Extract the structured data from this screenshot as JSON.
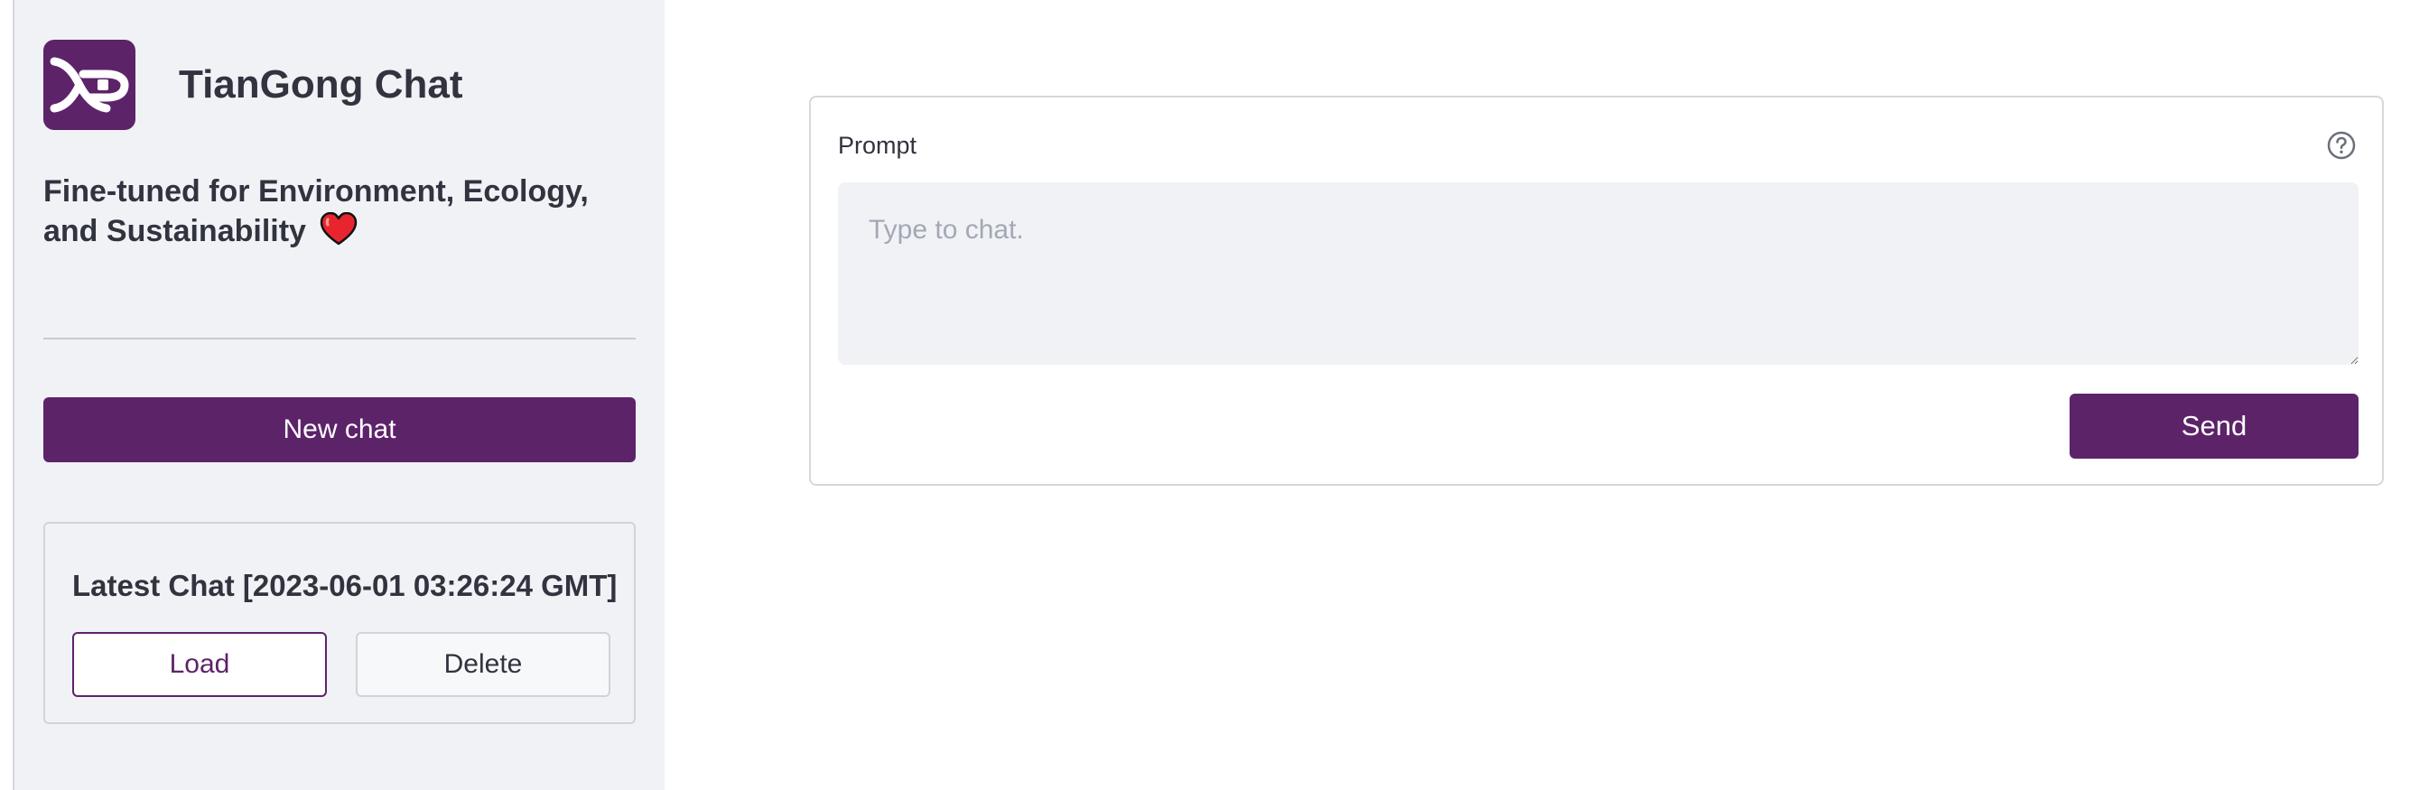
{
  "sidebar": {
    "app_title": "TianGong Chat",
    "tagline": "Fine-tuned for Environment, Ecology, and Sustainability",
    "logo_icon": "tiangong-logo-icon",
    "heart_icon": "red-heart-icon",
    "new_chat_label": "New chat",
    "latest_chat": {
      "title": "Latest Chat [2023-06-01 03:26:24 GMT]",
      "load_label": "Load",
      "delete_label": "Delete"
    }
  },
  "main": {
    "prompt": {
      "label": "Prompt",
      "placeholder": "Type to chat.",
      "value": "",
      "help_icon": "question-circle-icon",
      "send_label": "Send"
    }
  },
  "colors": {
    "accent": "#5d2369",
    "sidebar_bg": "#f0f2f6",
    "heart": "#e8252e",
    "text": "#31333f",
    "placeholder": "#a3a8b4"
  }
}
